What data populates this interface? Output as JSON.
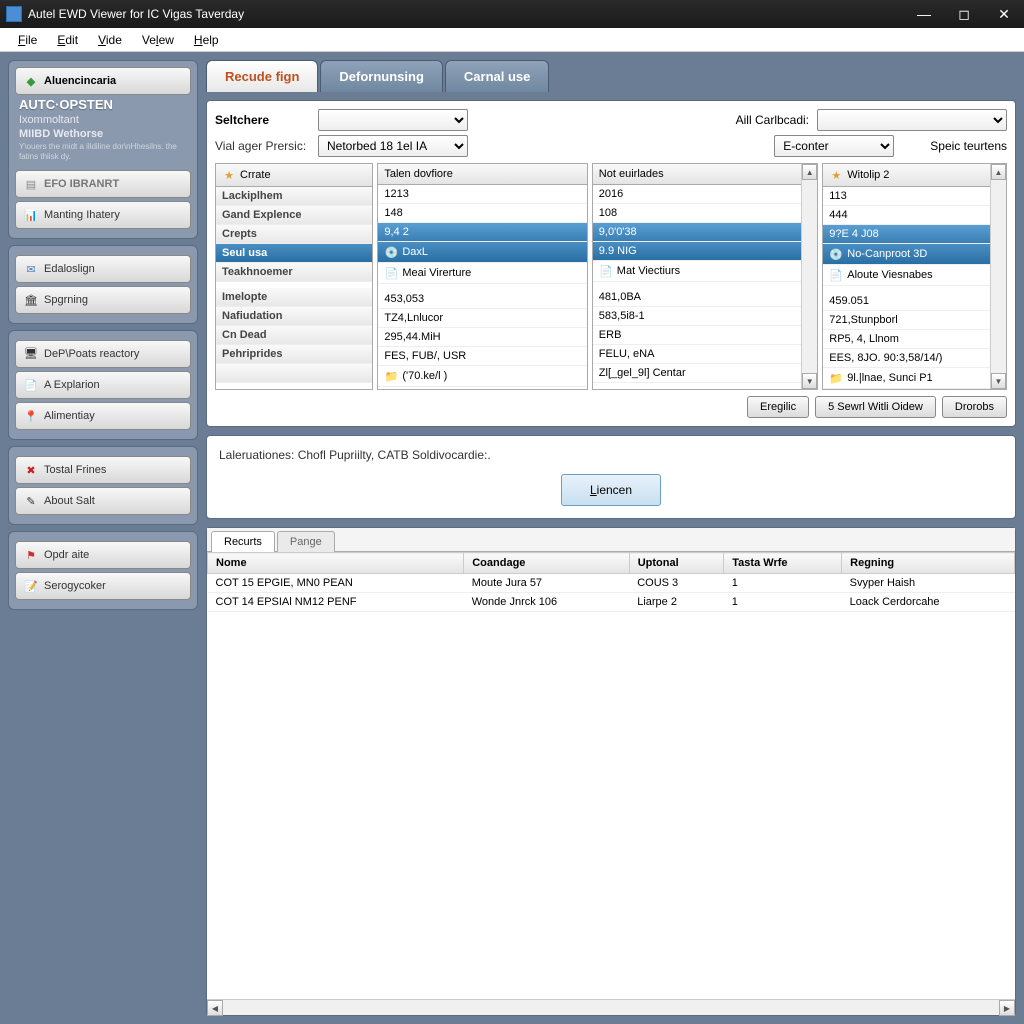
{
  "window": {
    "title": "Autel EWD Viewer for IC Vigas Taverday"
  },
  "menu": {
    "file": "File",
    "edit": "Edit",
    "vide": "Vide",
    "velew": "Velew",
    "help": "Help"
  },
  "sidebar": {
    "header_btn": "Aluencincaria",
    "title": "AUTC·OPSTEN",
    "sub1": "Ixommoltant",
    "sub2": "MIIBD Wethorse",
    "tiny": "Y\\ouers the midt a illdiline dor\\nHhesilns. the fatins thiisk dy.",
    "group1": {
      "b1": "EFO IBRANRT",
      "b2": "Manting Ihatery"
    },
    "group2": {
      "b1": "Edaloslign",
      "b2": "Spgrning"
    },
    "group3": {
      "b1": "DeP\\Poats reactory",
      "b2": "A Explarion",
      "b3": "Alimentiay"
    },
    "group4": {
      "b1": "Tostal Frines",
      "b2": "About Salt"
    },
    "group5": {
      "b1": "Opdr aite",
      "b2": "Serogycoker"
    }
  },
  "tabs": {
    "t1": "Recude fign",
    "t2": "Defornunsing",
    "t3": "Carnal use"
  },
  "filters": {
    "l1": "Seltchere",
    "v1": "",
    "l2": "Vial ager Prersic:",
    "v2": "Netorbed 18 1el IA",
    "r1": "Aill Carlbcadi:",
    "rv1": "",
    "r2": "E-conter",
    "r3": "Speic teurtens"
  },
  "cols": {
    "left": {
      "h": "Crrate",
      "r1": "Lackiplhem",
      "r2": "Gand Explence",
      "r3": "Crepts",
      "r4": "Seul usa",
      "r5": "Teakhnoemer",
      "r6": "Imelopte",
      "r7": "Nafiudation",
      "r8": "Cn Dead",
      "r9": "Pehriprides"
    },
    "c1": {
      "h": "Talen dovfiore",
      "r1": "1213",
      "r2": "148",
      "r3": "9,4 2",
      "r4": "DaxL",
      "r5": "Meai Virerture",
      "r6": "453,053",
      "r7": "TZ4,Lnlucor",
      "r8": "295,44.MiH",
      "r9": "FES, FUB/, USR",
      "r10": "('70.ke/l )"
    },
    "c2": {
      "h": "Not euirlades",
      "r1": "2016",
      "r2": "108",
      "r3": "9,0'0'38",
      "r4": "9.9 NIG",
      "r5": "Mat Viectiurs",
      "r6": "481,0BA",
      "r7": "583,5i8-1",
      "r8": "ERB",
      "r9": "FELU, eNA",
      "r10": "Zl[_gel_9l] Centar"
    },
    "c3": {
      "h": "Witolip 2",
      "r1": "113",
      "r2": "444",
      "r3": "9?E 4 J08",
      "r4": "No-Canproot 3D",
      "r5": "Aloute Viesnabes",
      "r6": "459.051",
      "r7": "721,Stunpborl",
      "r8": "RP5, 4, Llnom",
      "r9": "EES, 8JO. 90:3,58/14/)",
      "r10": "9l.|lnae, Sunci P1"
    }
  },
  "actions": {
    "b1": "Eregilic",
    "b2": "5 Sewrl Witli Oidew",
    "b3": "Drorobs"
  },
  "info": {
    "text": "Laleruationes: Chofl Pupriilty, CATB Soldivocardie:.",
    "btn": "Liencen"
  },
  "lower": {
    "tabs": {
      "t1": "Recurts",
      "t2": "Pange"
    },
    "headers": {
      "h1": "Nome",
      "h2": "Coandage",
      "h3": "Uptonal",
      "h4": "Tasta Wrfe",
      "h5": "Regning"
    },
    "rows": [
      {
        "c1": "COT 15 EPGIE, MN0 PEAN",
        "c2": "Moute Jura 57",
        "c3": "COUS 3",
        "c4": "1",
        "c5": "Svyper Haish"
      },
      {
        "c1": "COT 14 EPSIAl NM12 PENF",
        "c2": "Wonde Jnrck 106",
        "c3": "Liarpe 2",
        "c4": "1",
        "c5": "Loack Cerdorcahe"
      }
    ]
  }
}
